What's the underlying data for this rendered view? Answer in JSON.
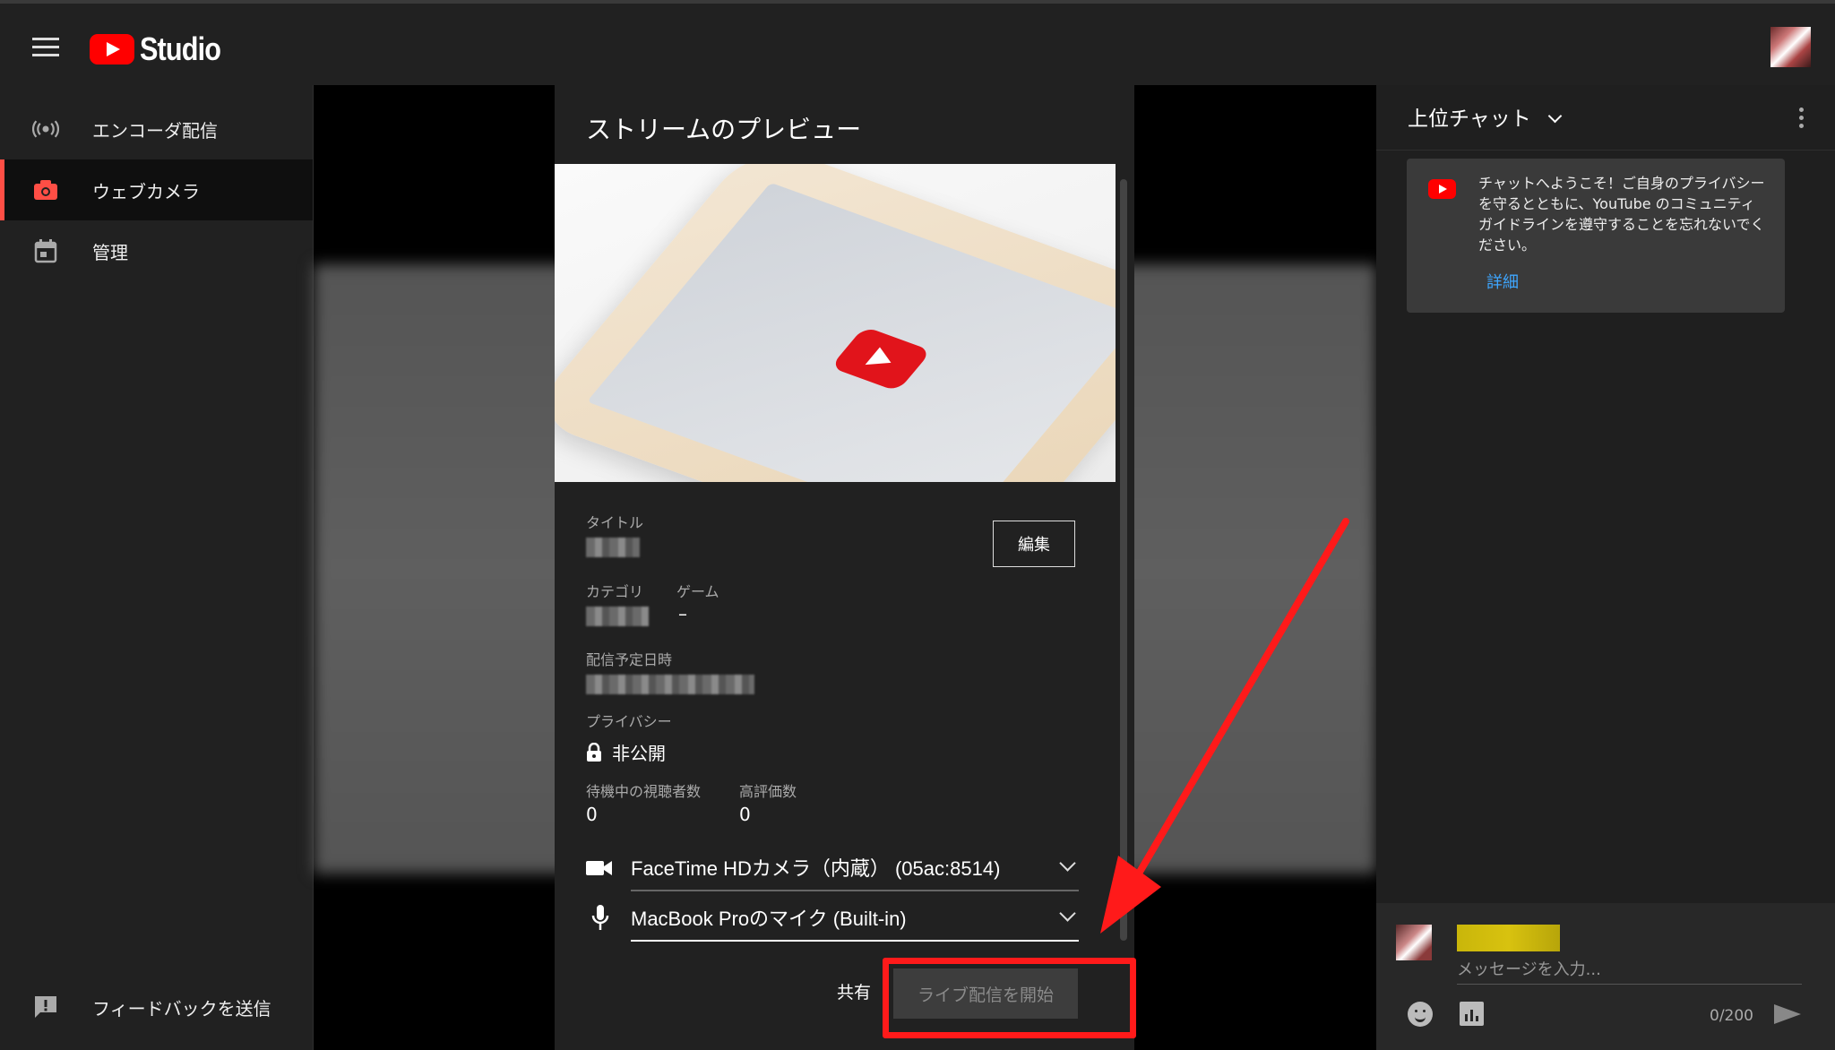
{
  "app": {
    "logo_text": "Studio"
  },
  "sidebar": {
    "items": [
      {
        "label": "エンコーダ配信",
        "icon": "broadcast-icon"
      },
      {
        "label": "ウェブカメラ",
        "icon": "camera-icon",
        "active": true
      },
      {
        "label": "管理",
        "icon": "calendar-icon"
      }
    ],
    "feedback_label": "フィードバックを送信"
  },
  "preview": {
    "title": "ストリームのプレビュー",
    "fields": {
      "title_label": "タイトル",
      "category_label": "カテゴリ",
      "game_label": "ゲーム",
      "game_value": "–",
      "schedule_label": "配信予定日時",
      "privacy_label": "プライバシー",
      "privacy_value": "非公開",
      "waiting_label": "待機中の視聴者数",
      "waiting_value": "0",
      "likes_label": "高評価数",
      "likes_value": "0"
    },
    "edit_label": "編集",
    "camera_select": "FaceTime HDカメラ（内蔵） (05ac:8514)",
    "mic_select": "MacBook Proのマイク (Built-in)",
    "share_label": "共有",
    "golive_label": "ライブ配信を開始"
  },
  "chat": {
    "title": "上位チャット",
    "welcome_text": "チャットへようこそ！ご自身のプライバシーを守るとともに、YouTube のコミュニティ ガイドラインを遵守することを忘れないでください。",
    "welcome_link": "詳細",
    "input_placeholder": "メッセージを入力...",
    "counter": "0/200"
  },
  "colors": {
    "accent": "#ff0000",
    "highlight": "#ff1a1a",
    "link": "#3ea6ff"
  }
}
